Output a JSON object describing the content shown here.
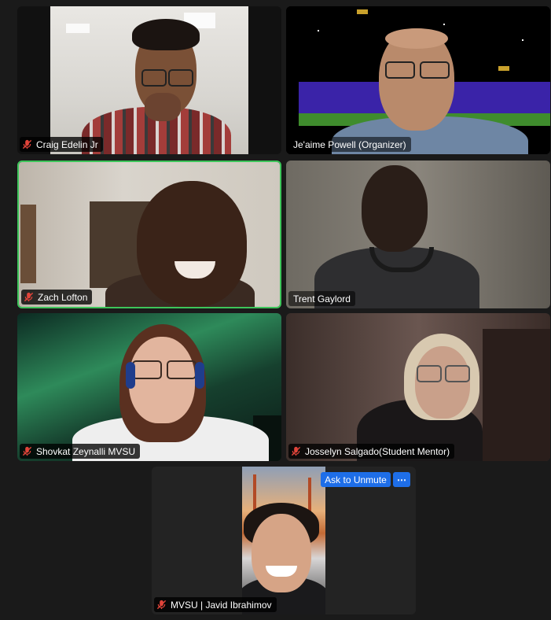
{
  "participants": [
    {
      "name": "Craig Edelin Jr",
      "muted": true
    },
    {
      "name": "Je'aime Powell (Organizer)",
      "muted": false
    },
    {
      "name": "Zach Lofton",
      "muted": true,
      "active_speaker": true
    },
    {
      "name": "Trent Gaylord",
      "muted": false
    },
    {
      "name": "Shovkat Zeynalli MVSU",
      "muted": true
    },
    {
      "name": "Josselyn Salgado(Student Mentor)",
      "muted": true
    },
    {
      "name": "MVSU | Javid Ibrahimov",
      "muted": true
    }
  ],
  "controls": {
    "ask_to_unmute": "Ask to Unmute",
    "more": "⋯"
  },
  "icons": {
    "muted": "muted-mic-icon"
  },
  "colors": {
    "active_border": "#3dc55a",
    "button": "#1e6ee8",
    "muted_mic": "#e0443a"
  }
}
